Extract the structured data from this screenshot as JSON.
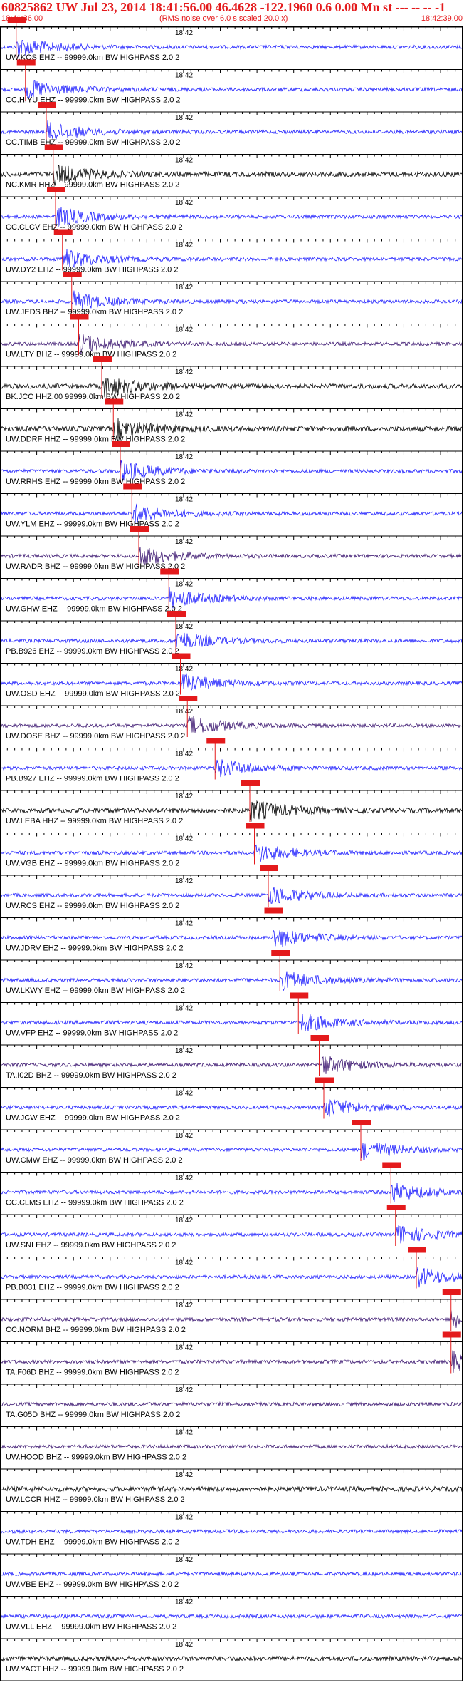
{
  "header": {
    "title": "60825862 UW Jul 23, 2014 18:41:56.00   46.4628 -122.1960  0.6 0.00 Mn st --- -- --  -1",
    "start_time": "18:41:36.00",
    "end_time": "18:42:39.00",
    "note": "(RMS noise over 6.0 s scaled 20.0 x)"
  },
  "colors": {
    "header_text": "#e41a1c",
    "pick_marker": "#e41a1c",
    "trace_blue": "#1f1fff",
    "trace_black": "#000000",
    "trace_purple": "#3b1670",
    "frame": "#000000"
  },
  "chart_data": {
    "type": "line",
    "title": "60825862 UW Jul 23, 2014 18:41:56.00   46.4628 -122.1960  0.6 0.00 Mn st --- -- --  -1",
    "x_range_label": [
      "18:41:36.00",
      "18:42:39.00"
    ],
    "time_tick_label": "18:42",
    "traces": [
      {
        "label": "UW.KOS EHZ -- 99999.0km BW  HIGHPASS  2.0  2",
        "color": "blue",
        "pick": 0.035
      },
      {
        "label": "CC.HIYU EHZ -- 99999.0km BW  HIGHPASS  2.0  2",
        "color": "blue",
        "pick": 0.055
      },
      {
        "label": "CC.TIMB EHZ -- 99999.0km BW  HIGHPASS  2.0  2",
        "color": "blue",
        "pick": 0.1
      },
      {
        "label": "NC.KMR HHZ -- 99999.0km BW  HIGHPASS  2.0  2",
        "color": "black",
        "pick": 0.115
      },
      {
        "label": "CC.CLCV EHZ -- 99999.0km BW  HIGHPASS  2.0  2",
        "color": "blue",
        "pick": 0.12
      },
      {
        "label": "UW.DY2 EHZ -- 99999.0km BW  HIGHPASS  2.0  2",
        "color": "blue",
        "pick": 0.135
      },
      {
        "label": "UW.JEDS BHZ -- 99999.0km BW  HIGHPASS  2.0  2",
        "color": "blue",
        "pick": 0.155
      },
      {
        "label": "UW.LTY BHZ -- 99999.0km BW  HIGHPASS  2.0  2",
        "color": "purple",
        "pick": 0.17
      },
      {
        "label": "BK.JCC HHZ.00 99999.0km BW  HIGHPASS  2.0  2",
        "color": "black",
        "pick": 0.22
      },
      {
        "label": "UW.DDRF HHZ -- 99999.0km BW  HIGHPASS  2.0  2",
        "color": "black",
        "pick": 0.245
      },
      {
        "label": "UW.RRHS EHZ -- 99999.0km BW  HIGHPASS  2.0  2",
        "color": "blue",
        "pick": 0.26
      },
      {
        "label": "UW.YLM EHZ -- 99999.0km BW  HIGHPASS  2.0  2",
        "color": "blue",
        "pick": 0.285
      },
      {
        "label": "UW.RADR BHZ -- 99999.0km BW  HIGHPASS  2.0  2",
        "color": "purple",
        "pick": 0.3
      },
      {
        "label": "UW.GHW EHZ -- 99999.0km BW  HIGHPASS  2.0  2",
        "color": "blue",
        "pick": 0.365
      },
      {
        "label": "PB.B926 EHZ -- 99999.0km BW  HIGHPASS  2.0  2",
        "color": "blue",
        "pick": 0.38
      },
      {
        "label": "UW.OSD EHZ -- 99999.0km BW  HIGHPASS  2.0  2",
        "color": "blue",
        "pick": 0.39
      },
      {
        "label": "UW.DOSE BHZ -- 99999.0km BW  HIGHPASS  2.0  2",
        "color": "purple",
        "pick": 0.405
      },
      {
        "label": "PB.B927 EHZ -- 99999.0km BW  HIGHPASS  2.0  2",
        "color": "blue",
        "pick": 0.465
      },
      {
        "label": "UW.LEBA HHZ -- 99999.0km BW  HIGHPASS  2.0  2",
        "color": "black",
        "pick": 0.54
      },
      {
        "label": "UW.VGB EHZ -- 99999.0km BW  HIGHPASS  2.0  2",
        "color": "blue",
        "pick": 0.55
      },
      {
        "label": "UW.RCS EHZ -- 99999.0km BW  HIGHPASS  2.0  2",
        "color": "blue",
        "pick": 0.58
      },
      {
        "label": "UW.JDRV EHZ -- 99999.0km BW  HIGHPASS  2.0  2",
        "color": "blue",
        "pick": 0.59
      },
      {
        "label": "UW.LKWY EHZ -- 99999.0km BW  HIGHPASS  2.0  2",
        "color": "blue",
        "pick": 0.605
      },
      {
        "label": "UW.VFP EHZ -- 99999.0km BW  HIGHPASS  2.0  2",
        "color": "blue",
        "pick": 0.645
      },
      {
        "label": "TA.I02D BHZ -- 99999.0km BW  HIGHPASS  2.0  2",
        "color": "purple",
        "pick": 0.69
      },
      {
        "label": "UW.JCW EHZ -- 99999.0km BW  HIGHPASS  2.0  2",
        "color": "blue",
        "pick": 0.7
      },
      {
        "label": "UW.CMW EHZ -- 99999.0km BW  HIGHPASS  2.0  2",
        "color": "blue",
        "pick": 0.78
      },
      {
        "label": "CC.CLMS EHZ -- 99999.0km BW  HIGHPASS  2.0  2",
        "color": "blue",
        "pick": 0.845
      },
      {
        "label": "UW.SNI EHZ -- 99999.0km BW  HIGHPASS  2.0  2",
        "color": "blue",
        "pick": 0.855
      },
      {
        "label": "PB.B031 EHZ -- 99999.0km BW  HIGHPASS  2.0  2",
        "color": "blue",
        "pick": 0.9
      },
      {
        "label": "CC.NORM BHZ -- 99999.0km BW  HIGHPASS  2.0  2",
        "color": "purple",
        "pick": 0.975
      },
      {
        "label": "TA.F06D BHZ -- 99999.0km BW  HIGHPASS  2.0  2",
        "color": "purple",
        "pick": 0.975
      },
      {
        "label": "TA.G05D BHZ -- 99999.0km BW  HIGHPASS  2.0  2",
        "color": "purple",
        "pick": null
      },
      {
        "label": "UW.HOOD BHZ -- 99999.0km BW  HIGHPASS  2.0  2",
        "color": "purple",
        "pick": null
      },
      {
        "label": "UW.LCCR HHZ -- 99999.0km BW  HIGHPASS  2.0  2",
        "color": "black",
        "pick": null
      },
      {
        "label": "UW.TDH EHZ -- 99999.0km BW  HIGHPASS  2.0  2",
        "color": "blue",
        "pick": null
      },
      {
        "label": "UW.VBE EHZ -- 99999.0km BW  HIGHPASS  2.0  2",
        "color": "blue",
        "pick": null
      },
      {
        "label": "UW.VLL EHZ -- 99999.0km BW  HIGHPASS  2.0  2",
        "color": "blue",
        "pick": null
      },
      {
        "label": "UW.YACT HHZ -- 99999.0km BW  HIGHPASS  2.0  2",
        "color": "black",
        "pick": null
      }
    ]
  }
}
